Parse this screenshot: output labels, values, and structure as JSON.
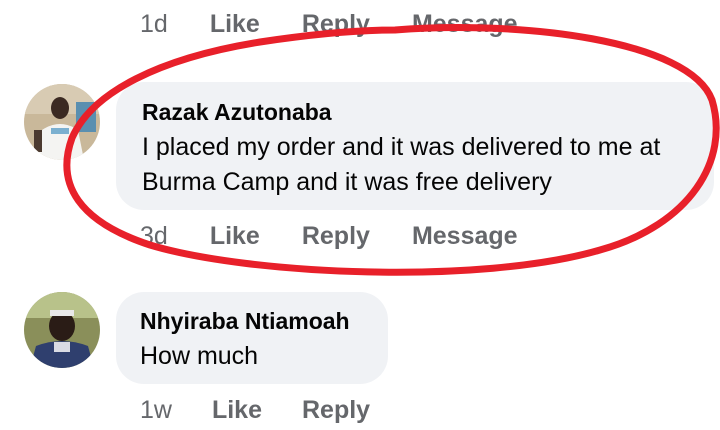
{
  "top_comment": {
    "timestamp": "1d",
    "like_label": "Like",
    "reply_label": "Reply",
    "message_label": "Message"
  },
  "comments": [
    {
      "author": "Razak Azutonaba",
      "text": "I placed my order and it was delivered to me at Burma Camp and it was free delivery",
      "timestamp": "3d",
      "like_label": "Like",
      "reply_label": "Reply",
      "message_label": "Message"
    },
    {
      "author": "Nhyiraba Ntiamoah",
      "text": "How much",
      "timestamp": "1w",
      "like_label": "Like",
      "reply_label": "Reply"
    }
  ],
  "colors": {
    "bubble_bg": "#f0f2f5",
    "action_text": "#65676b",
    "highlight_ring": "#e8202a"
  }
}
